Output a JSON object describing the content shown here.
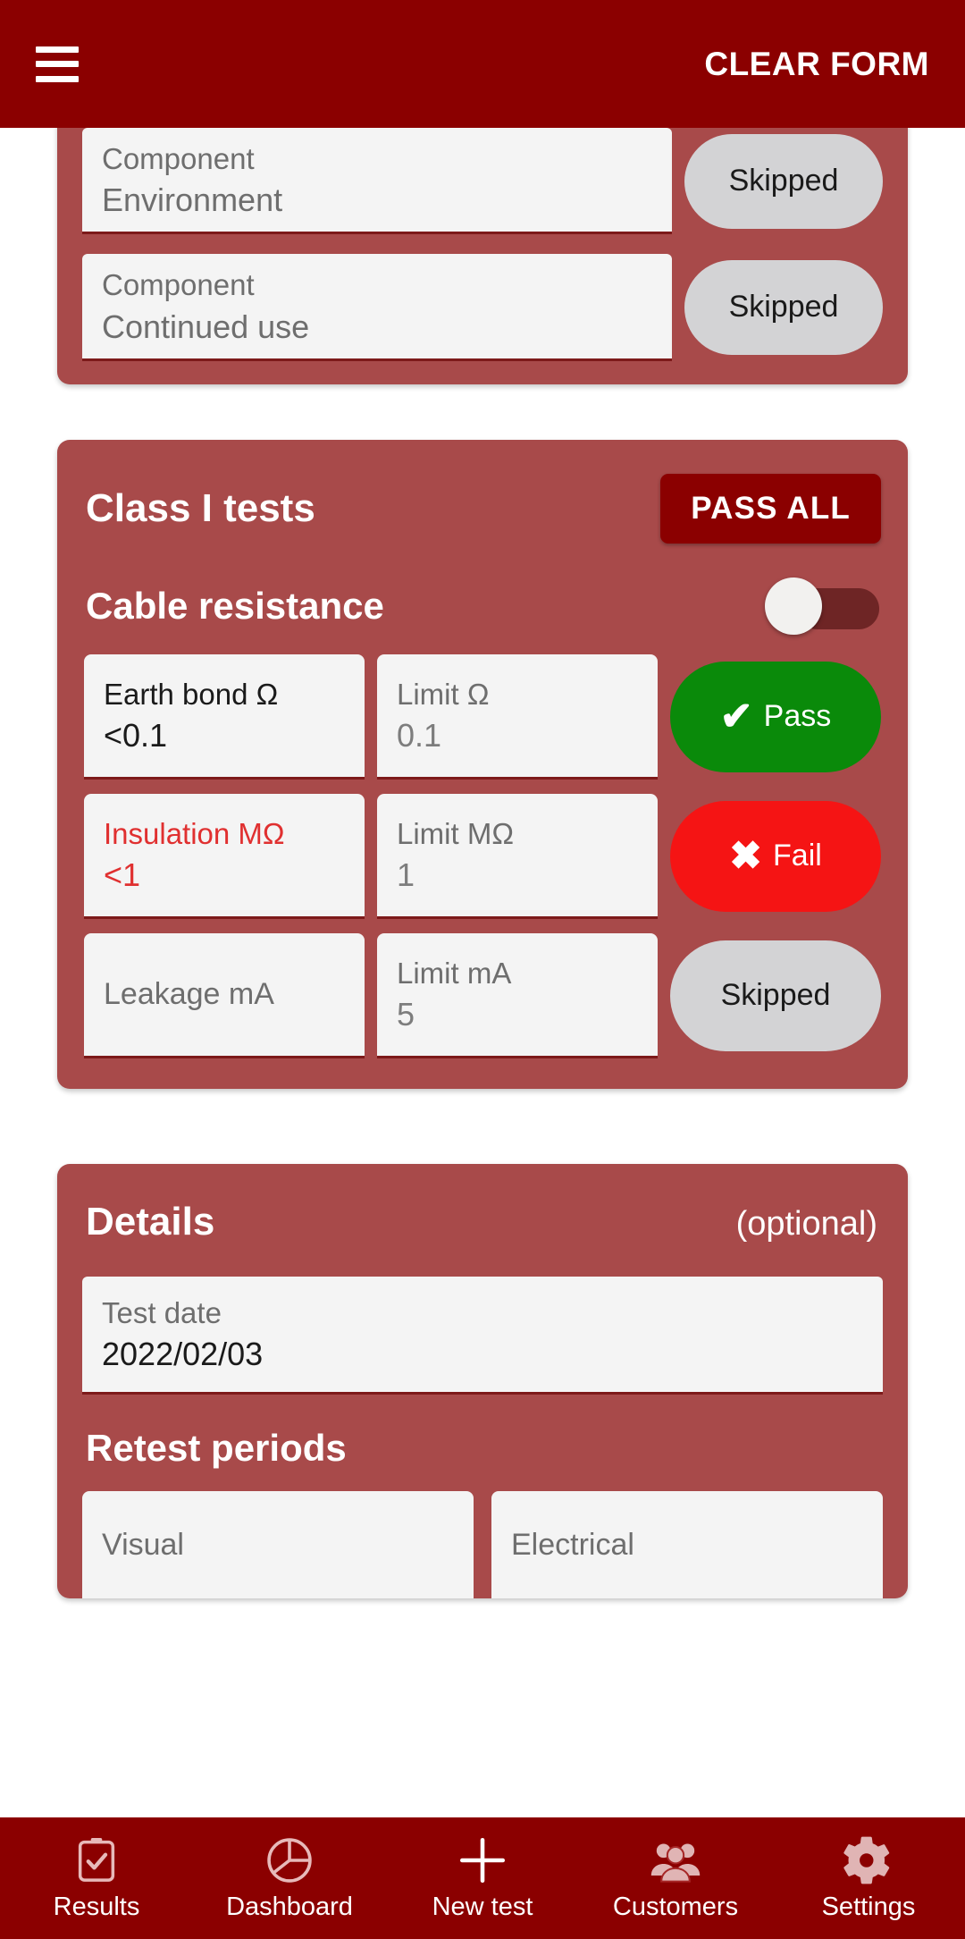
{
  "appbar": {
    "menu_icon": "hamburger-menu-icon",
    "clear_form_label": "CLEAR FORM"
  },
  "colors": {
    "appbar_background": "#8b0000",
    "card_background": "#a84a4a",
    "page_background": "#ffffff",
    "field_background": "#f4f4f4",
    "field_underline": "#7d1a1a",
    "pass_green": "#0a8a0a",
    "fail_red": "#f51414",
    "skipped_grey": "#d3d3d5",
    "error_text": "#e03030",
    "button_dark_red": "#8b0000"
  },
  "visual_card": {
    "rows": [
      {
        "label": "Component",
        "value": "Environment",
        "status": "Skipped"
      },
      {
        "label": "Component",
        "value": "Continued use",
        "status": "Skipped"
      }
    ]
  },
  "class_one_card": {
    "title": "Class I tests",
    "pass_all_label": "PASS ALL",
    "section_title": "Cable resistance",
    "toggle_state": "off",
    "tests": [
      {
        "measure_label": "Earth bond Ω",
        "measure_value": "<0.1",
        "measure_error": false,
        "limit_label": "Limit Ω",
        "limit_value": "0.1",
        "status": "Pass",
        "status_kind": "pass",
        "status_glyph": "✔"
      },
      {
        "measure_label": "Insulation MΩ",
        "measure_value": "<1",
        "measure_error": true,
        "limit_label": "Limit MΩ",
        "limit_value": "1",
        "status": "Fail",
        "status_kind": "fail",
        "status_glyph": "✖"
      },
      {
        "measure_label": "Leakage mA",
        "measure_value": "",
        "measure_error": false,
        "limit_label": "Limit mA",
        "limit_value": "5",
        "status": "Skipped",
        "status_kind": "skipped",
        "status_glyph": ""
      }
    ]
  },
  "details_card": {
    "title": "Details",
    "optional_label": "(optional)",
    "test_date": {
      "label": "Test date",
      "value": "2022/02/03"
    },
    "retest_title": "Retest periods",
    "retest_fields": [
      {
        "label": "Visual",
        "value": ""
      },
      {
        "label": "Electrical",
        "value": ""
      }
    ]
  },
  "bottom_nav": {
    "items": [
      {
        "label": "Results",
        "icon": "clipboard-check-icon"
      },
      {
        "label": "Dashboard",
        "icon": "pie-chart-icon"
      },
      {
        "label": "New test",
        "icon": "plus-icon"
      },
      {
        "label": "Customers",
        "icon": "people-group-icon"
      },
      {
        "label": "Settings",
        "icon": "gear-icon"
      }
    ]
  }
}
